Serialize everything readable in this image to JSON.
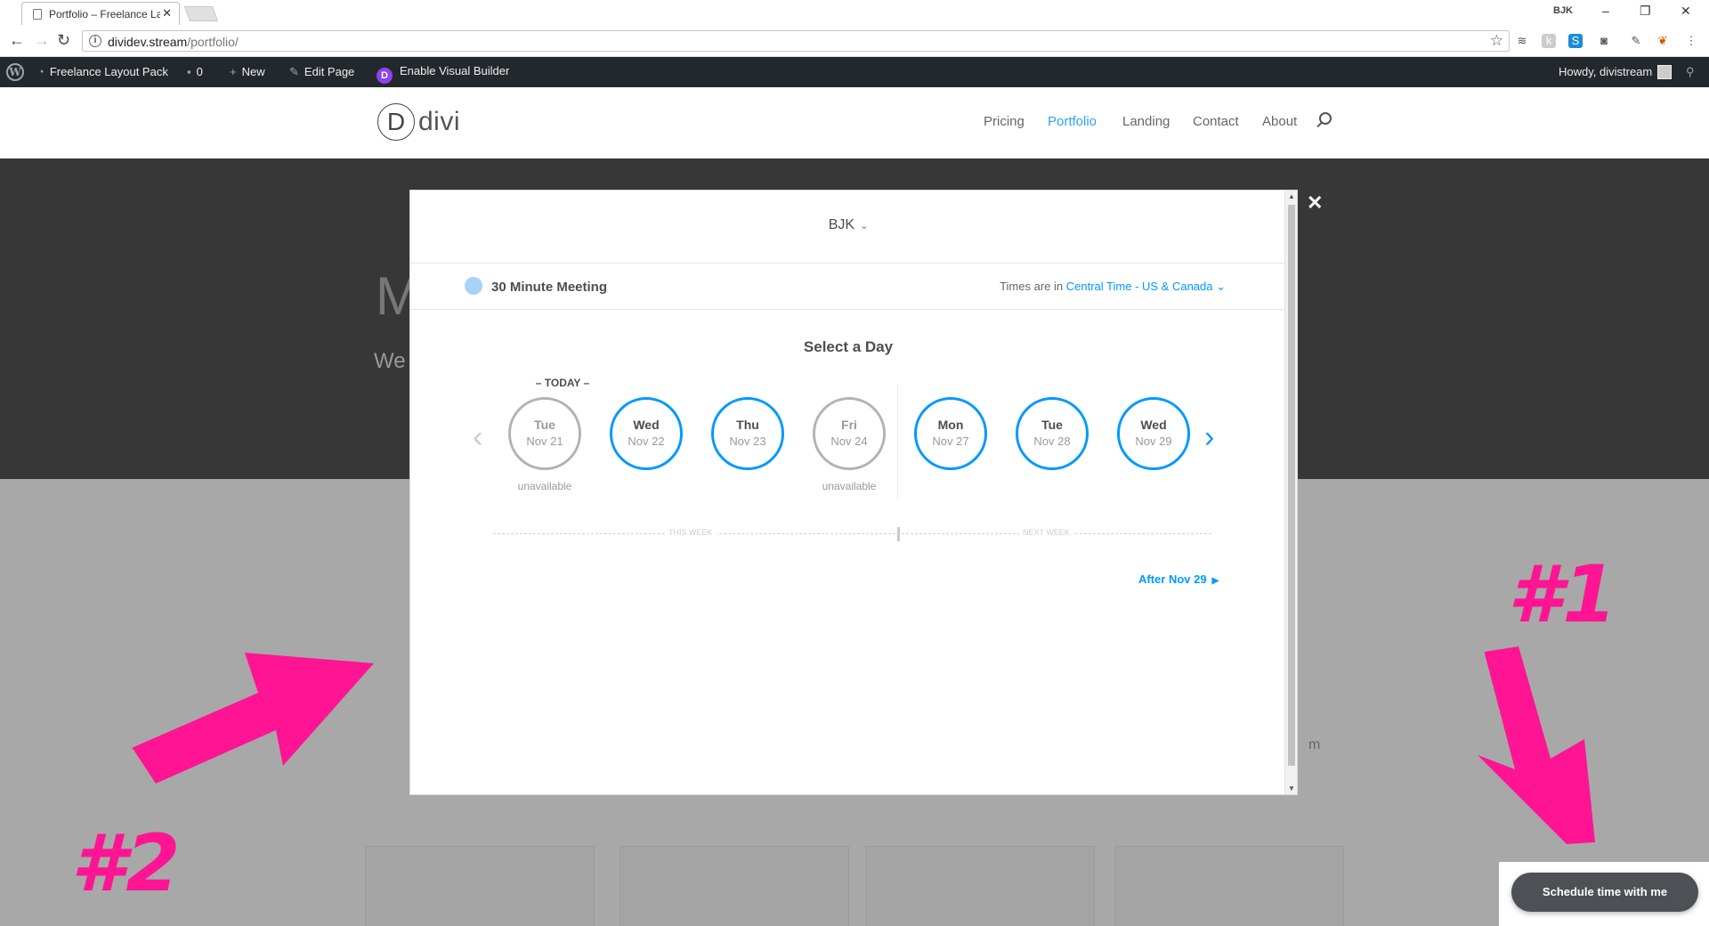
{
  "browser": {
    "tab_title": "Portfolio – Freelance Layout Pack",
    "url_host": "dividev.stream",
    "url_path": "/portfolio/",
    "profile_badge": "BJK",
    "controls": {
      "minimize": "–",
      "restore": "❐",
      "close": "✕"
    },
    "nav": {
      "back": "←",
      "forward": "→",
      "reload": "↻"
    },
    "bookmark_icon": "☆"
  },
  "admin_bar": {
    "site_name": "Freelance Layout Pack",
    "comments_count": "0",
    "new_label": "New",
    "edit_label": "Edit Page",
    "visual_builder_label": "Enable Visual Builder",
    "howdy": "Howdy, divistream"
  },
  "site": {
    "logo_letter": "D",
    "logo_word": "divi",
    "nav": [
      "Pricing",
      "Portfolio",
      "Landing",
      "Contact",
      "About"
    ],
    "active_nav": "Portfolio",
    "accent_color": "#2ea3f2",
    "hero_title_fragment": "M",
    "hero_sub_fragment": "We",
    "stray_text": "m"
  },
  "scheduler": {
    "owner": "BJK",
    "meeting_name": "30 Minute Meeting",
    "tz_prefix": "Times are in",
    "tz_value": "Central Time - US & Canada",
    "heading": "Select a Day",
    "today_label": "– TODAY –",
    "unavailable_label": "unavailable",
    "days": [
      {
        "dow": "Tue",
        "date": "Nov 21",
        "available": false
      },
      {
        "dow": "Wed",
        "date": "Nov 22",
        "available": true
      },
      {
        "dow": "Thu",
        "date": "Nov 23",
        "available": true
      },
      {
        "dow": "Fri",
        "date": "Nov 24",
        "available": false
      },
      {
        "dow": "Mon",
        "date": "Nov 27",
        "available": true
      },
      {
        "dow": "Tue",
        "date": "Nov 28",
        "available": true
      },
      {
        "dow": "Wed",
        "date": "Nov 29",
        "available": true
      }
    ],
    "this_week_label": "THIS WEEK",
    "next_week_label": "NEXT WEEK",
    "after_label": "After Nov 29",
    "accent_color": "#0099ff",
    "close_icon": "✕"
  },
  "widget": {
    "button_label": "Schedule time with me"
  },
  "annotations": {
    "one": "#1",
    "two": "#2",
    "color": "#ff1493"
  }
}
